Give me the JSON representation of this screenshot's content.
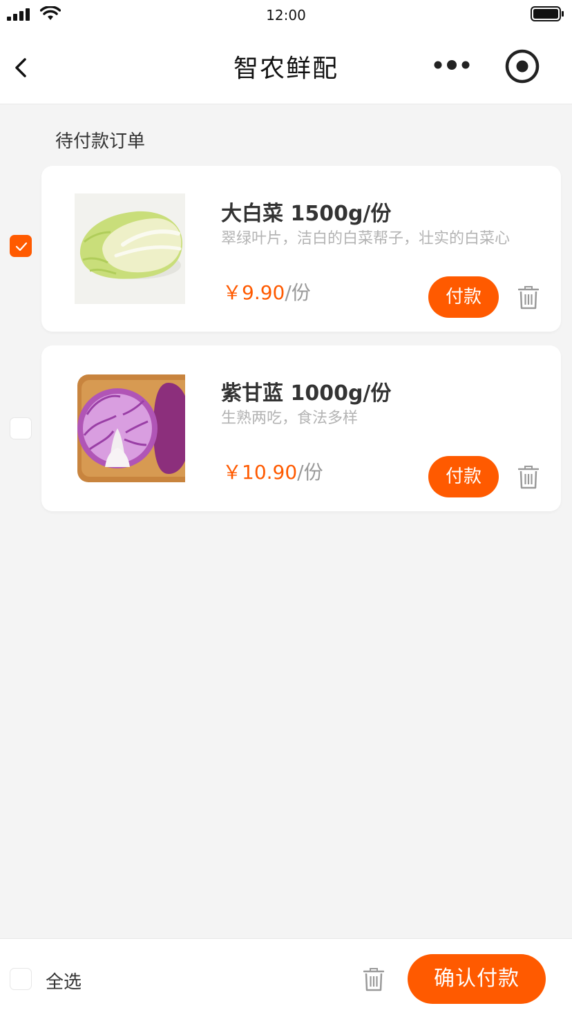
{
  "status_bar": {
    "time": "12:00"
  },
  "nav": {
    "title": "智农鲜配"
  },
  "section_title": "待付款订单",
  "colors": {
    "accent": "#ff5a00",
    "background": "#f4f4f4"
  },
  "items": [
    {
      "name": "大白菜 1500g/份",
      "description": "翠绿叶片，洁白的白菜帮子，壮实的白菜心",
      "price": "￥9.90",
      "unit": "/份",
      "pay_label": "付款",
      "checked": true,
      "image": "napa-cabbage-photo"
    },
    {
      "name": "紫甘蓝 1000g/份",
      "description": "生熟两吃，食法多样",
      "price": "￥10.90",
      "unit": "/份",
      "pay_label": "付款",
      "checked": false,
      "image": "red-cabbage-photo"
    }
  ],
  "bottom_bar": {
    "select_all_label": "全选",
    "confirm_label": "确认付款"
  }
}
